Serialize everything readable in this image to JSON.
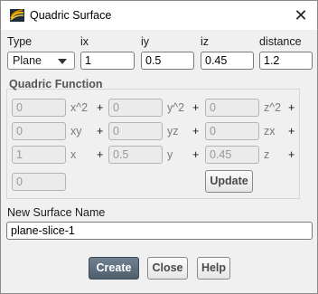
{
  "window": {
    "title": "Quadric Surface"
  },
  "top": {
    "type_label": "Type",
    "type_value": "Plane",
    "ix_label": "ix",
    "ix_value": "1",
    "iy_label": "iy",
    "iy_value": "0.5",
    "iz_label": "iz",
    "iz_value": "0.45",
    "distance_label": "distance",
    "distance_value": "1.2"
  },
  "quadric": {
    "title": "Quadric Function",
    "rows": [
      [
        {
          "value": "0",
          "suffix": "x^2"
        },
        {
          "value": "0",
          "suffix": "y^2"
        },
        {
          "value": "0",
          "suffix": "z^2"
        }
      ],
      [
        {
          "value": "0",
          "suffix": "xy"
        },
        {
          "value": "0",
          "suffix": "yz"
        },
        {
          "value": "0",
          "suffix": "zx"
        }
      ],
      [
        {
          "value": "1",
          "suffix": "x"
        },
        {
          "value": "0.5",
          "suffix": "y"
        },
        {
          "value": "0.45",
          "suffix": "z"
        }
      ]
    ],
    "constant": "0",
    "plus": "+",
    "update_label": "Update"
  },
  "new_surface": {
    "label": "New Surface Name",
    "value": "plane-slice-1"
  },
  "buttons": {
    "create": "Create",
    "close": "Close",
    "help": "Help"
  },
  "colors": {
    "primary_button": "#5a6b7a",
    "window_bg": "#f0f0f0"
  }
}
